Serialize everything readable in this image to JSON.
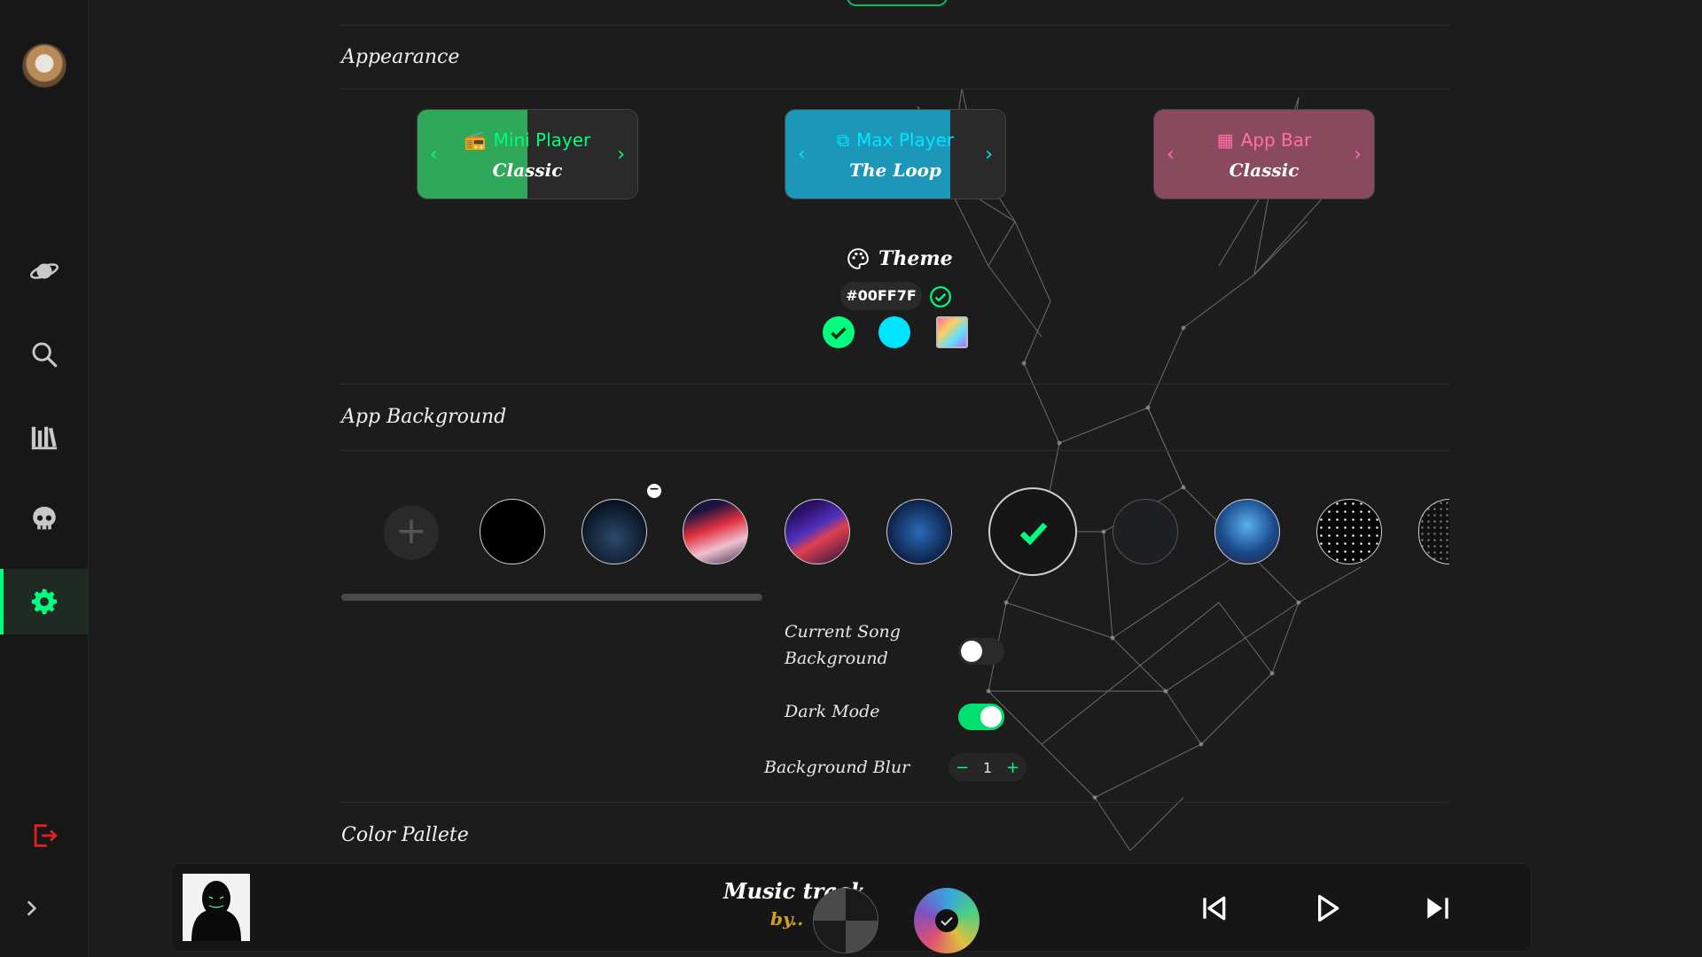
{
  "sidebar": {
    "items": [
      {
        "name": "explore-planet-icon"
      },
      {
        "name": "search-icon"
      },
      {
        "name": "library-icon"
      },
      {
        "name": "skull-icon"
      },
      {
        "name": "settings-gear-icon",
        "active": true
      },
      {
        "name": "logout-icon"
      },
      {
        "name": "expand-chevron-icon"
      }
    ]
  },
  "appearance": {
    "title": "Appearance",
    "cards": [
      {
        "title": "Mini Player",
        "value": "Classic",
        "color": "#2fa85a",
        "text_color": "#00ff7f",
        "fill": 0.5
      },
      {
        "title": "Max Player",
        "value": "The Loop",
        "color": "#1d97b8",
        "text_color": "#00e6ff",
        "fill": 0.75
      },
      {
        "title": "App Bar",
        "value": "Classic",
        "color": "#8a4a5d",
        "text_color": "#ff6fa8",
        "fill": 1.0
      }
    ],
    "theme": {
      "label": "Theme",
      "hex": "#00FF7F",
      "swatches": [
        "#00ff7f",
        "#00e5ff",
        "gradient"
      ],
      "selected": 0
    }
  },
  "app_background": {
    "title": "App Background",
    "selected_index": 6,
    "settings": {
      "current_song_label_1": "Current Song",
      "current_song_label_2": "Background",
      "current_song_on": false,
      "dark_mode_label": "Dark Mode",
      "dark_mode_on": true,
      "blur_label": "Background Blur",
      "blur_value": "1",
      "blur_minus": "−",
      "blur_plus": "+"
    }
  },
  "color_palette": {
    "title": "Color Pallete"
  },
  "player": {
    "title": "Music track",
    "by": "by..",
    "controls": [
      "previous-icon",
      "play-icon",
      "next-icon"
    ]
  },
  "colors": {
    "accent": "#00ff7f",
    "logout": "#e02020"
  }
}
